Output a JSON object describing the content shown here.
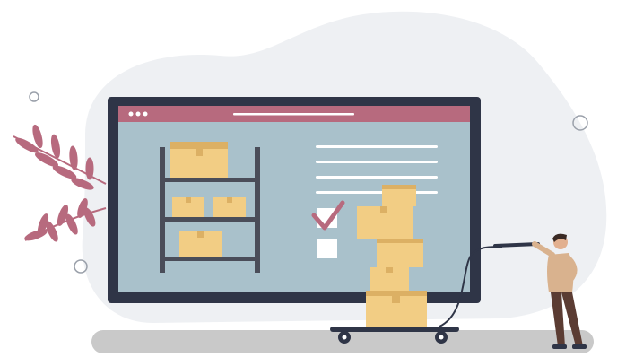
{
  "scene": {
    "subject": "warehouse-inventory-management-illustration",
    "icons": [
      "monitor-icon",
      "shelf-icon",
      "box-icon",
      "checklist-icon",
      "checkmark-icon",
      "hand-truck-icon",
      "person-icon",
      "leaf-icon"
    ],
    "colors": {
      "background_blob": "#eef0f3",
      "monitor_frame": "#2f3547",
      "screen": "#a9c1cb",
      "title_bar": "#b76a7e",
      "shelf": "#4a4d59",
      "box": "#f2cd84",
      "box_shadow": "#dcb064",
      "check": "#b76a7e",
      "floor": "#c9c9c9",
      "person_shirt": "#d9b28e",
      "person_pants": "#5b3c33",
      "leaves": "#b76a7e"
    }
  }
}
